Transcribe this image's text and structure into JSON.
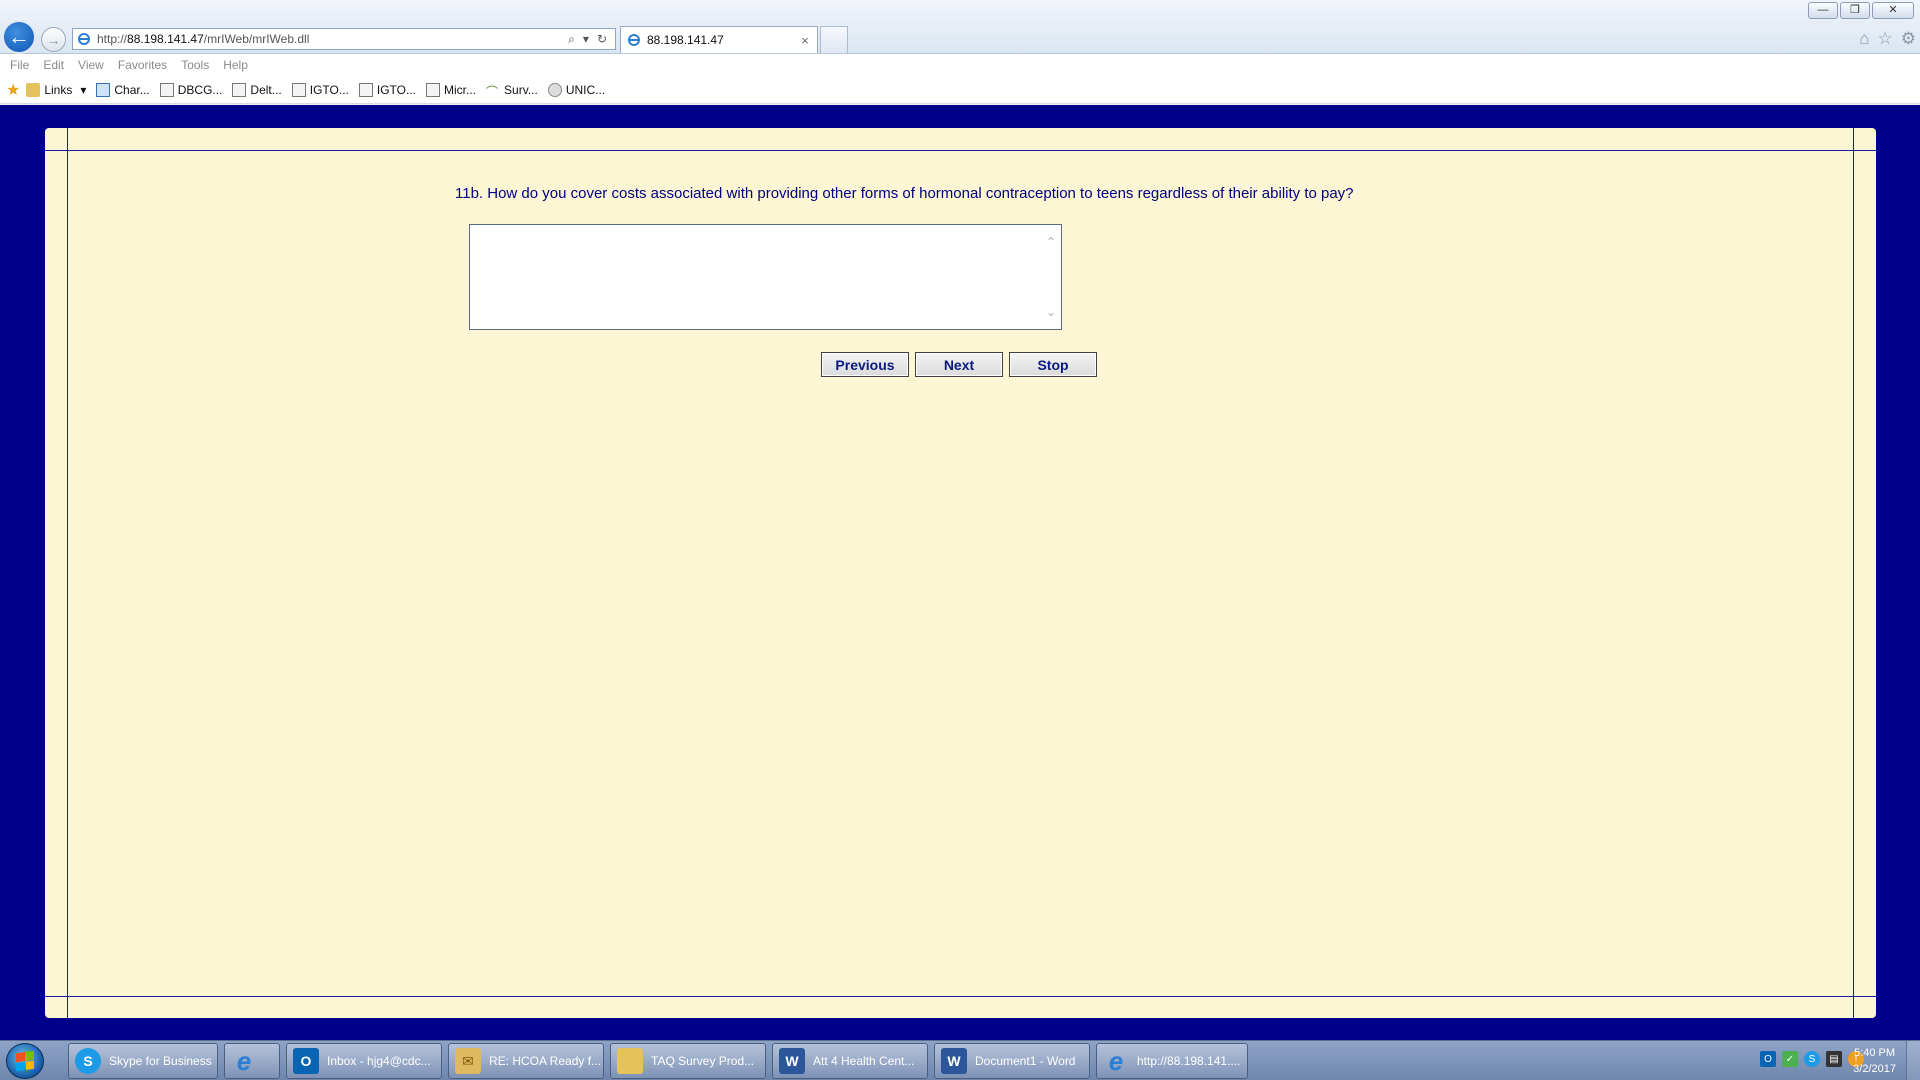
{
  "browser": {
    "window_controls": [
      "—",
      "❐",
      "✕"
    ],
    "address": {
      "url_prefix": "http://",
      "url_host": "88.198.141.47",
      "url_path": "/mrIWeb/mrIWeb.dll"
    },
    "tab": {
      "title": "88.198.141.47",
      "close": "×"
    },
    "menu": [
      "File",
      "Edit",
      "View",
      "Favorites",
      "Tools",
      "Help"
    ],
    "favorites": [
      {
        "label": "Links",
        "icon": "folder-icon"
      },
      {
        "label": "Char...",
        "icon": "page-icon"
      },
      {
        "label": "DBCG...",
        "icon": "page-icon"
      },
      {
        "label": "Delt...",
        "icon": "page-icon"
      },
      {
        "label": "IGTO...",
        "icon": "page-icon"
      },
      {
        "label": "IGTO...",
        "icon": "page-icon"
      },
      {
        "label": "Micr...",
        "icon": "page-icon"
      },
      {
        "label": "Surv...",
        "icon": "survey-icon"
      },
      {
        "label": "UNIC...",
        "icon": "globe-icon"
      }
    ]
  },
  "survey": {
    "question": "11b. How do you cover costs associated with providing other forms of hormonal contraception to teens regardless of their ability to pay?",
    "answer_value": "",
    "buttons": {
      "previous": "Previous",
      "next": "Next",
      "stop": "Stop"
    }
  },
  "taskbar": {
    "items": [
      {
        "label": "Skype for Business",
        "icon": "skype-icon",
        "color": "#1e9be6"
      },
      {
        "label": "",
        "icon": "internet-explorer-icon",
        "color": "#2a7fd4"
      },
      {
        "label": "Inbox - hjg4@cdc...",
        "icon": "outlook-icon",
        "color": "#0a64b4"
      },
      {
        "label": "RE: HCOA Ready f...",
        "icon": "envelope-icon",
        "color": "#e0b860"
      },
      {
        "label": "TAQ Survey Prod...",
        "icon": "folder-icon",
        "color": "#e6c35a"
      },
      {
        "label": "Att 4 Health Cent...",
        "icon": "word-icon",
        "color": "#2b579a"
      },
      {
        "label": "Document1 - Word",
        "icon": "word-icon",
        "color": "#2b579a"
      },
      {
        "label": "http://88.198.141....",
        "icon": "internet-explorer-icon",
        "color": "#2a7fd4"
      }
    ],
    "clock": {
      "time": "5:40 PM",
      "date": "3/2/2017"
    }
  },
  "colors": {
    "page_border": "#00008b",
    "panel_bg": "#fcf6d5",
    "question_text": "#000080"
  }
}
